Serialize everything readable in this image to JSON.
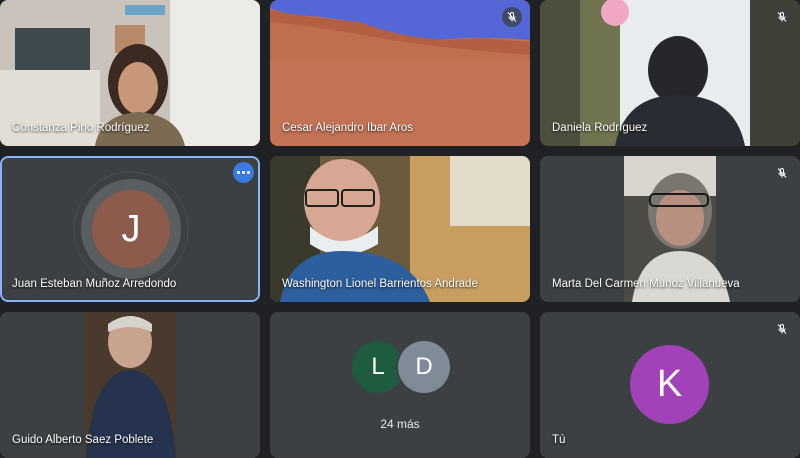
{
  "participants": [
    {
      "name": "Constanza Pino Rodríguez"
    },
    {
      "name": "Cesar Alejandro Ibar Aros"
    },
    {
      "name": "Daniela Rodríguez"
    },
    {
      "name": "Juan Esteban Muñoz Arredondo",
      "initial": "J",
      "avatar_color": "#8d5b4c"
    },
    {
      "name": "Washington Lionel Barrientos Andrade"
    },
    {
      "name": "Marta Del Carmen Munoz Villanueva"
    },
    {
      "name": "Guido Alberto Saez Poblete"
    },
    {
      "name": "Tú",
      "initial": "K",
      "avatar_color": "#a142b8"
    }
  ],
  "overflow": {
    "initials": [
      "L",
      "D"
    ],
    "colors": [
      "#1e5b3f",
      "#7f8c97"
    ],
    "label": "24 más"
  },
  "icons": {
    "mic_off": "mic-off-icon",
    "more": "more-options-icon"
  },
  "colors": {
    "background": "#202124",
    "tile": "#3c4043",
    "active_border": "#8ab4f8",
    "more_button": "#3a7be0"
  }
}
